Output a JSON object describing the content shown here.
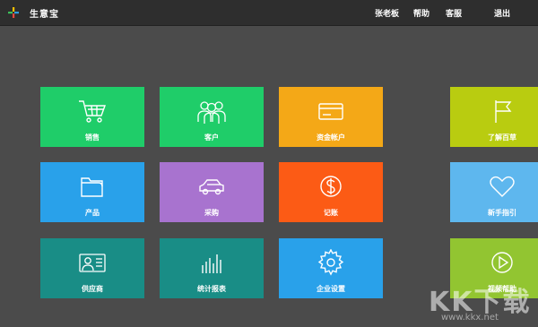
{
  "header": {
    "title": "生意宝",
    "user": "张老板",
    "help": "帮助",
    "service": "客服",
    "logout": "退出"
  },
  "tiles": {
    "sales": {
      "label": "销售",
      "color": "#1fcd69",
      "icon": "cart-icon"
    },
    "customers": {
      "label": "客户",
      "color": "#1fcd69",
      "icon": "users-icon"
    },
    "funds": {
      "label": "资金帐户",
      "color": "#f4a817",
      "icon": "card-icon"
    },
    "products": {
      "label": "产品",
      "color": "#29a1ea",
      "icon": "folder-icon"
    },
    "purchase": {
      "label": "采购",
      "color": "#a873cf",
      "icon": "car-icon"
    },
    "bookkeeping": {
      "label": "记账",
      "color": "#fc5b15",
      "icon": "dollar-icon"
    },
    "suppliers": {
      "label": "供应商",
      "color": "#198d86",
      "icon": "id-card-icon"
    },
    "reports": {
      "label": "统计报表",
      "color": "#198d86",
      "icon": "bar-chart-icon"
    },
    "settings": {
      "label": "企业设置",
      "color": "#29a1ea",
      "icon": "gear-icon"
    },
    "about": {
      "label": "了解百草",
      "color": "#b9cc10",
      "icon": "flag-icon"
    },
    "guide": {
      "label": "新手指引",
      "color": "#5eb7ee",
      "icon": "heart-icon"
    },
    "video": {
      "label": "视频帮助",
      "color": "#92c531",
      "icon": "play-icon"
    }
  },
  "watermark": {
    "text": "KK下载",
    "url": "www.kkx.net"
  }
}
